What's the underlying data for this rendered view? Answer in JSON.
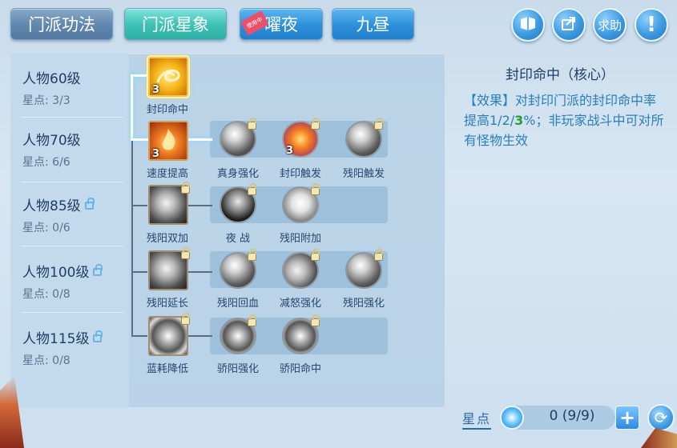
{
  "tabs": [
    {
      "label": "门派功法",
      "style": "steel"
    },
    {
      "label": "门派星象",
      "style": "teal"
    },
    {
      "label": "曜夜",
      "style": "blue",
      "badge": "使用中"
    },
    {
      "label": "九昼",
      "style": "blue"
    }
  ],
  "top_buttons": {
    "help_label": "求助",
    "alert_label": "!"
  },
  "levels": [
    {
      "name": "人物60级",
      "stars": "星点: 3/3",
      "locked": false
    },
    {
      "name": "人物70级",
      "stars": "星点: 6/6",
      "locked": false
    },
    {
      "name": "人物85级",
      "stars": "星点: 0/6",
      "locked": true
    },
    {
      "name": "人物100级",
      "stars": "星点: 0/8",
      "locked": true
    },
    {
      "name": "人物115级",
      "stars": "星点: 0/8",
      "locked": true
    }
  ],
  "skills": {
    "row1": [
      {
        "name": "封印命中",
        "level": "3"
      }
    ],
    "row2": [
      {
        "name": "速度提高",
        "level": "3"
      },
      {
        "name": "真身强化",
        "level": ""
      },
      {
        "name": "封印触发",
        "level": "3"
      },
      {
        "name": "残阳触发",
        "level": ""
      }
    ],
    "row3": [
      {
        "name": "残阳双加"
      },
      {
        "name": "夜 战"
      },
      {
        "name": "残阳附加"
      }
    ],
    "row4": [
      {
        "name": "残阳延长"
      },
      {
        "name": "残阳回血"
      },
      {
        "name": "减怒强化"
      },
      {
        "name": "残阳强化"
      }
    ],
    "row5": [
      {
        "name": "蓝耗降低"
      },
      {
        "name": "骄阳强化"
      },
      {
        "name": "骄阳命中"
      }
    ]
  },
  "detail": {
    "title": "封印命中（核心）",
    "desc_prefix": "【效果】对封印门派的封印命中率提高1/2/",
    "desc_highlight": "3",
    "desc_suffix": "%；非玩家战斗中可对所有怪物生效"
  },
  "star_bar": {
    "label": "星点",
    "value": "0 (9/9)",
    "plus": "+"
  },
  "colors": {
    "accent": "#2d8fd9",
    "selected_tab": "#3cc0b3",
    "highlight_text": "#2a9a3a"
  }
}
